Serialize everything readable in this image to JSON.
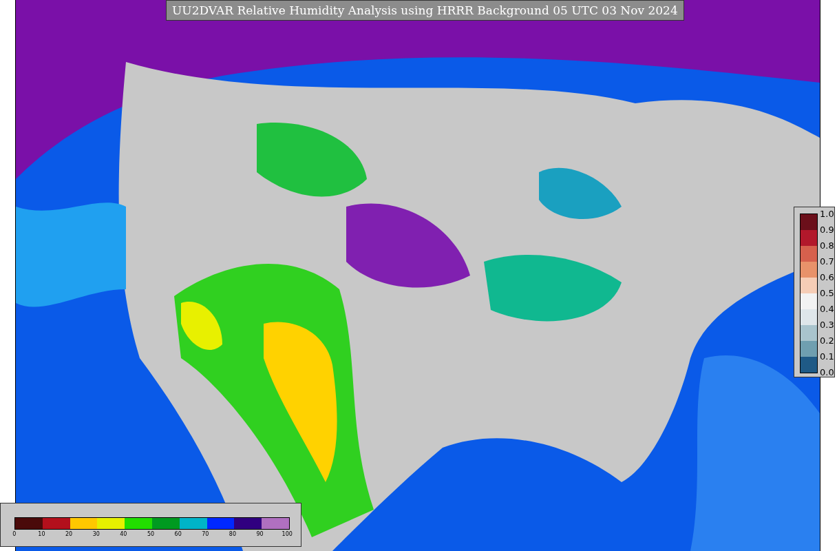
{
  "title": "UU2DVAR Relative Humidity Analysis using HRRR Background 05 UTC 03 Nov 2024",
  "observation_legend": {
    "ticks": [
      "1.0",
      "0.9",
      "0.8",
      "0.7",
      "0.6",
      "0.5",
      "0.4",
      "0.3",
      "0.2",
      "0.1",
      "0.0"
    ],
    "swatches": [
      {
        "color": "#6b0f1a"
      },
      {
        "color": "#b2182b"
      },
      {
        "color": "#d6604d"
      },
      {
        "color": "#e8926a"
      },
      {
        "color": "#f6cdb6"
      },
      {
        "color": "#f2f2f2"
      },
      {
        "color": "#dfe6ea"
      },
      {
        "color": "#a9c4cd"
      },
      {
        "color": "#6f9fb0"
      },
      {
        "color": "#1f5a86"
      }
    ]
  },
  "analysis_legend": {
    "ticks": [
      "0",
      "10",
      "20",
      "30",
      "40",
      "50",
      "60",
      "70",
      "80",
      "90",
      "100"
    ],
    "swatches": [
      {
        "color": "#4a0a0a"
      },
      {
        "color": "#b3101c"
      },
      {
        "color": "#ffc800"
      },
      {
        "color": "#e6f000"
      },
      {
        "color": "#22dd00"
      },
      {
        "color": "#009a20"
      },
      {
        "color": "#00b4c8"
      },
      {
        "color": "#0028ff"
      },
      {
        "color": "#300080"
      },
      {
        "color": "#b070c0"
      }
    ]
  }
}
